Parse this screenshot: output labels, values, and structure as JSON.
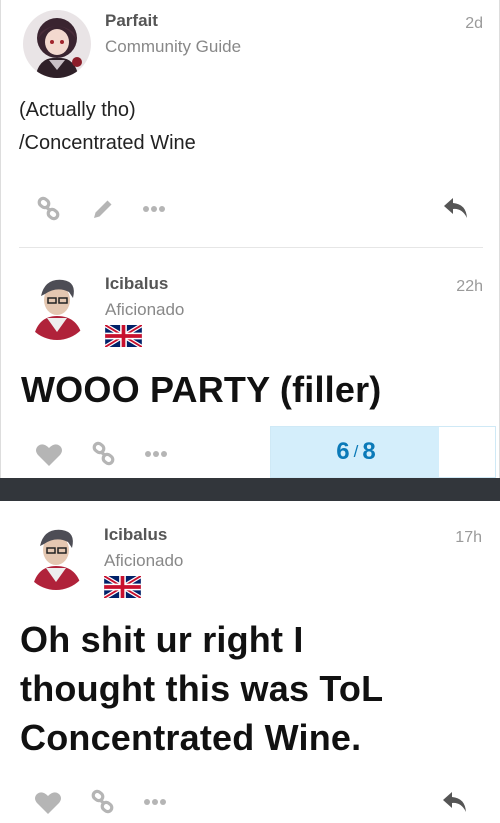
{
  "posts": [
    {
      "username": "Parfait",
      "user_title": "Community Guide",
      "date": "2d",
      "body_lines": [
        "(Actually tho)",
        "/Concentrated Wine"
      ]
    },
    {
      "username": "Icibalus",
      "user_title": "Aficionado",
      "date": "22h",
      "body_lines": [
        "WOOO PARTY (filler)"
      ]
    },
    {
      "username": "Icibalus",
      "user_title": "Aficionado",
      "date": "17h",
      "body_lines": [
        "Oh shit ur right I",
        "thought this was ToL",
        "Concentrated Wine."
      ]
    }
  ],
  "progress": {
    "current": "6",
    "separator": "/",
    "total": "8",
    "fraction": 0.75
  },
  "icons": [
    "link-icon",
    "edit-icon",
    "more-icon",
    "reply-icon",
    "like-icon",
    "uk-flag-icon"
  ],
  "colors": {
    "progress_text": "#0b7ab8",
    "progress_fill": "#d4eefb",
    "gap": "#32363b"
  }
}
